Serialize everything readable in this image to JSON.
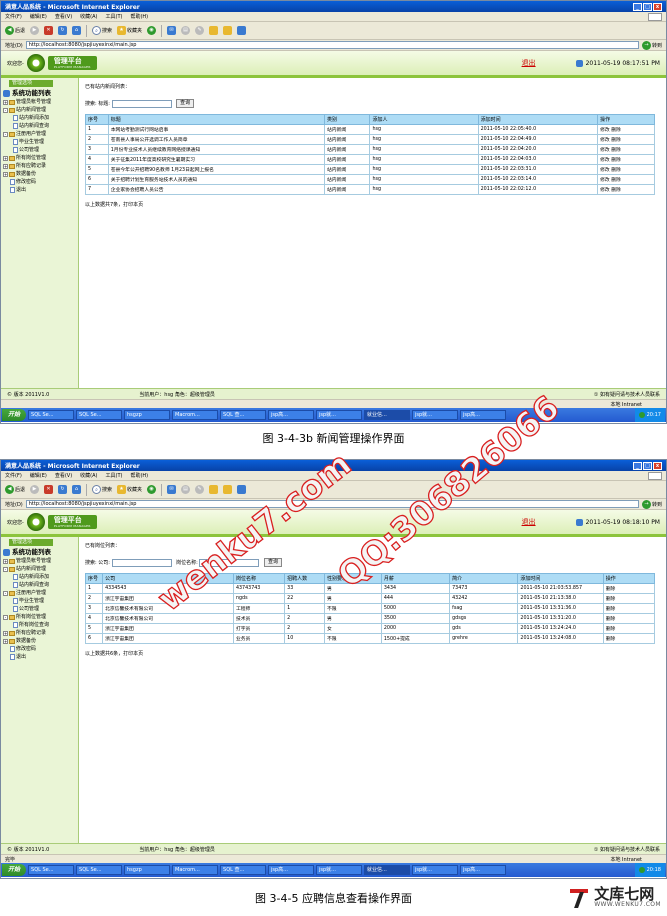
{
  "windows": [
    {
      "title": "满意人品系统 - Microsoft Internet Explorer",
      "menus": [
        "文件(F)",
        "编辑(E)",
        "查看(V)",
        "收藏(A)",
        "工具(T)",
        "帮助(H)"
      ],
      "back_label": "后退",
      "search_label": "搜索",
      "favorites_label": "收藏夹",
      "address_label": "地址(D)",
      "address": "http://localhost:8080/jspjiuyexinxi/main.jsp",
      "go_label": "转到",
      "welcome": "欢迎您-",
      "badge": "管理平台",
      "badge_sub": "PLATFORM MANAGER",
      "logout": "退出",
      "datetime": "2011-05-19 08:17:51 PM",
      "side_header": "管理选项",
      "side_root": "系统功能列表",
      "tree": [
        {
          "label": "管理员帐号管理",
          "level": 0,
          "kind": "plus"
        },
        {
          "label": "站内新闻管理",
          "level": 0,
          "kind": "minus"
        },
        {
          "label": "站内新闻添加",
          "level": 1,
          "kind": "page"
        },
        {
          "label": "站内新闻查询",
          "level": 1,
          "kind": "page"
        },
        {
          "label": "注册用户管理",
          "level": 0,
          "kind": "minus"
        },
        {
          "label": "毕业生管理",
          "level": 1,
          "kind": "page"
        },
        {
          "label": "公司管理",
          "level": 1,
          "kind": "page"
        },
        {
          "label": "所有岗位管理",
          "level": 0,
          "kind": "plus"
        },
        {
          "label": "所有应聘记录",
          "level": 0,
          "kind": "plus"
        },
        {
          "label": "数据备份",
          "level": 0,
          "kind": "plus"
        },
        {
          "label": "修改密码",
          "level": 2,
          "kind": "page"
        },
        {
          "label": "退出",
          "level": 2,
          "kind": "page"
        }
      ],
      "list_title": "已有站内新闻列表：",
      "search_fields": [
        "搜索: 标题:"
      ],
      "search_button": "查询",
      "columns": [
        "序号",
        "标题",
        "类别",
        "添加人",
        "添加时间",
        "操作"
      ],
      "rows": [
        [
          "1",
          "本网站考勤测试行网站启事",
          "站内新闻",
          "hsg",
          "2011-05-10 22:05:40.0",
          "修改 删除"
        ],
        [
          "2",
          "苍南县人事局公开选调工作人员简章",
          "站内新闻",
          "hsg",
          "2011-05-10 22:04:49.0",
          "修改 删除"
        ],
        [
          "3",
          "1月份专业技术人员继续教育网络授课通知",
          "站内新闻",
          "hsg",
          "2011-05-10 22:04:20.0",
          "修改 删除"
        ],
        [
          "4",
          "关于征集2011年度高校研究生暑期实习",
          "站内新闻",
          "hsg",
          "2011-05-10 22:04:03.0",
          "修改 删除"
        ],
        [
          "5",
          "苍县今年公开招聘90名教师 1月23日起网上报名",
          "站内新闻",
          "hsg",
          "2011-05-10 22:03:31.0",
          "修改 删除"
        ],
        [
          "6",
          "关于招聘计划生育服务站技术人员的通知",
          "站内新闻",
          "hsg",
          "2011-05-10 22:03:14.0",
          "修改 删除"
        ],
        [
          "7",
          "企业家协会招聘人员公告",
          "站内新闻",
          "hsg",
          "2011-05-10 22:02:12.0",
          "修改 删除"
        ]
      ],
      "footer": "以上数据共7条，打印本页",
      "status_left": "© 版本 2011V1.0",
      "status_mid": "当前用户：hsg  角色：超级管理员",
      "status_right": "① 如有疑问请与技术人员联系",
      "ie_status": "",
      "zone": "本地 Intranet",
      "taskbar": [
        "SQL Se...",
        "SQL Se...",
        "hsgzp",
        "Macrom...",
        "SQL 查...",
        "jsp高...",
        "jsp就...",
        "就业信...",
        "jsp就...",
        "jsp高..."
      ],
      "active_task": 7,
      "start": "开始",
      "clock": "20:17",
      "caption": "图 3-4-3b   新闻管理操作界面"
    },
    {
      "title": "满意人品系统 - Microsoft Internet Explorer",
      "menus": [
        "文件(F)",
        "编辑(E)",
        "查看(V)",
        "收藏(A)",
        "工具(T)",
        "帮助(H)"
      ],
      "back_label": "后退",
      "search_label": "搜索",
      "favorites_label": "收藏夹",
      "address_label": "地址(D)",
      "address": "http://localhost:8080/jspjiuyexinxi/main.jsp",
      "go_label": "转到",
      "welcome": "欢迎您-",
      "badge": "管理平台",
      "badge_sub": "PLATFORM MANAGER",
      "logout": "退出",
      "datetime": "2011-05-19 08:18:10 PM",
      "side_header": "管理选项",
      "side_root": "系统功能列表",
      "tree": [
        {
          "label": "管理员帐号管理",
          "level": 0,
          "kind": "plus"
        },
        {
          "label": "站内新闻管理",
          "level": 0,
          "kind": "minus"
        },
        {
          "label": "站内新闻添加",
          "level": 1,
          "kind": "page"
        },
        {
          "label": "站内新闻查询",
          "level": 1,
          "kind": "page"
        },
        {
          "label": "注册用户管理",
          "level": 0,
          "kind": "minus"
        },
        {
          "label": "毕业生管理",
          "level": 1,
          "kind": "page"
        },
        {
          "label": "公司管理",
          "level": 1,
          "kind": "page"
        },
        {
          "label": "所有岗位管理",
          "level": 0,
          "kind": "minus"
        },
        {
          "label": "所有岗位查询",
          "level": 1,
          "kind": "page"
        },
        {
          "label": "所有应聘记录",
          "level": 0,
          "kind": "plus"
        },
        {
          "label": "数据备份",
          "level": 0,
          "kind": "plus"
        },
        {
          "label": "修改密码",
          "level": 2,
          "kind": "page"
        },
        {
          "label": "退出",
          "level": 2,
          "kind": "page"
        }
      ],
      "list_title": "已有岗位列表：",
      "search_fields": [
        "搜索: 公司:",
        "岗位名称:"
      ],
      "search_button": "查询",
      "columns": [
        "序号",
        "公司",
        "岗位名称",
        "招聘人数",
        "性别要求",
        "月薪",
        "简介",
        "添加时间",
        "操作"
      ],
      "rows": [
        [
          "1",
          "4334543",
          "43743743",
          "33",
          "男",
          "3434",
          "73473",
          "2011-05-10 21:03:53.857",
          "删除"
        ],
        [
          "2",
          "浙江宇宙集团",
          "ngds",
          "22",
          "男",
          "444",
          "43242",
          "2011-05-10 21:13:38.0",
          "删除"
        ],
        [
          "3",
          "北京信馨技术有限公司",
          "工程师",
          "1",
          "不限",
          "5000",
          "fsag",
          "2011-05-10 13:31:36.0",
          "删除"
        ],
        [
          "4",
          "北京信馨技术有限公司",
          "技术员",
          "2",
          "男",
          "3500",
          "gdsgs",
          "2011-05-10 13:31:20.0",
          "删除"
        ],
        [
          "5",
          "浙江宇宙集团",
          "打字员",
          "2",
          "女",
          "2000",
          "gds",
          "2011-05-10 13:24:24.0",
          "删除"
        ],
        [
          "6",
          "浙江宇宙集团",
          "业务员",
          "10",
          "不限",
          "1500+提成",
          "grehre",
          "2011-05-10 13:24:08.0",
          "删除"
        ]
      ],
      "footer": "以上数据共6条，打印本页",
      "status_left": "© 版本 2011V1.0",
      "status_mid": "当前用户：hsg  角色：超级管理员",
      "status_right": "① 如有疑问请与技术人员联系",
      "ie_status": "完毕",
      "zone": "本地 Intranet",
      "taskbar": [
        "SQL Se...",
        "SQL Se...",
        "hsgzp",
        "Macrom...",
        "SQL 查...",
        "jsp高...",
        "jsp就...",
        "就业信...",
        "jsp就...",
        "jsp高..."
      ],
      "active_task": 7,
      "start": "开始",
      "clock": "20:18",
      "caption": "图 3-4-5   应聘信息查看操作界面"
    }
  ],
  "watermarks": [
    "wenku7.com",
    "QQ:306826066"
  ],
  "brand": {
    "name": "文库七网",
    "url": "WWW.WENKU7.COM"
  }
}
